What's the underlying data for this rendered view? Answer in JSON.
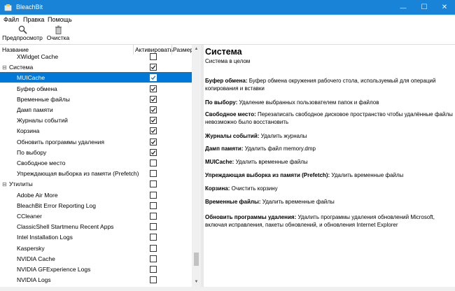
{
  "window": {
    "title": "BleachBit",
    "minimize_glyph": "—",
    "maximize_glyph": "☐",
    "close_glyph": "✕"
  },
  "menu": [
    "Файл",
    "Правка",
    "Помощь"
  ],
  "toolbar": {
    "preview_label": "Предпросмотр",
    "clean_label": "Очистка"
  },
  "tree": {
    "columns": {
      "name": "Название",
      "active": "Активировать",
      "size": "Размер"
    },
    "rows": [
      {
        "label": "XWidget Cache",
        "level": 1,
        "checked": false,
        "selected": false
      },
      {
        "label": "Система",
        "level": 0,
        "checked": true,
        "selected": false,
        "expander": "⊟"
      },
      {
        "label": "MUICache",
        "level": 1,
        "checked": true,
        "selected": true
      },
      {
        "label": "Буфер обмена",
        "level": 1,
        "checked": true,
        "selected": false
      },
      {
        "label": "Временные файлы",
        "level": 1,
        "checked": true,
        "selected": false
      },
      {
        "label": "Дамп памяти",
        "level": 1,
        "checked": true,
        "selected": false
      },
      {
        "label": "Журналы событий",
        "level": 1,
        "checked": true,
        "selected": false
      },
      {
        "label": "Корзина",
        "level": 1,
        "checked": true,
        "selected": false
      },
      {
        "label": "Обновить программы удаления",
        "level": 1,
        "checked": true,
        "selected": false
      },
      {
        "label": "По выбору",
        "level": 1,
        "checked": true,
        "selected": false
      },
      {
        "label": "Свободное место",
        "level": 1,
        "checked": false,
        "selected": false
      },
      {
        "label": "Упреждающая выборка из памяти (Prefetch)",
        "level": 1,
        "checked": false,
        "selected": false
      },
      {
        "label": "Утилиты",
        "level": 0,
        "checked": false,
        "selected": false,
        "expander": "⊟"
      },
      {
        "label": "Adobe Air More",
        "level": 1,
        "checked": false,
        "selected": false
      },
      {
        "label": "BleachBit Error Reporting Log",
        "level": 1,
        "checked": false,
        "selected": false
      },
      {
        "label": "CCleaner",
        "level": 1,
        "checked": false,
        "selected": false
      },
      {
        "label": "ClassicShell Startmenu Recent Apps",
        "level": 1,
        "checked": false,
        "selected": false
      },
      {
        "label": "Intel Installation Logs",
        "level": 1,
        "checked": false,
        "selected": false
      },
      {
        "label": "Kaspersky",
        "level": 1,
        "checked": false,
        "selected": false
      },
      {
        "label": "NVIDIA Cache",
        "level": 1,
        "checked": false,
        "selected": false
      },
      {
        "label": "NVIDIA GFExperience Logs",
        "level": 1,
        "checked": false,
        "selected": false
      },
      {
        "label": "NVIDIA Logs",
        "level": 1,
        "checked": false,
        "selected": false
      }
    ]
  },
  "description": {
    "title": "Система",
    "subtitle": "Система в целом",
    "entries": [
      {
        "name": "Буфер обмена:",
        "text": "Буфер обмена окружения рабочего стола, используемый для операций копирования и вставки"
      },
      {
        "name": "По выбору:",
        "text": "Удаление выбранных пользователем папок и файлов"
      },
      {
        "name": "Свободное место:",
        "text": "Перезаписать свободное дисковое пространство чтобы удалённые файлы невозможно было восстановить"
      },
      {
        "name": "Журналы событий:",
        "text": "Удалить журналы"
      },
      {
        "name": "Дамп памяти:",
        "text": "Удалить файл memory.dmp"
      },
      {
        "name": "MUICache:",
        "text": "Удалить временные файлы"
      },
      {
        "name": "Упреждающая выборка из памяти (Prefetch):",
        "text": "Удалить временные файлы"
      },
      {
        "name": "Корзина:",
        "text": "Очистить корзину"
      },
      {
        "name": "Временные файлы:",
        "text": "Удалить временные файлы"
      },
      {
        "name": "Обновить программы удаления:",
        "text": "Удалить программы удаления обновлений Microsoft, включая исправления, пакеты обновлений, и обновления Internet Explorer"
      }
    ]
  }
}
